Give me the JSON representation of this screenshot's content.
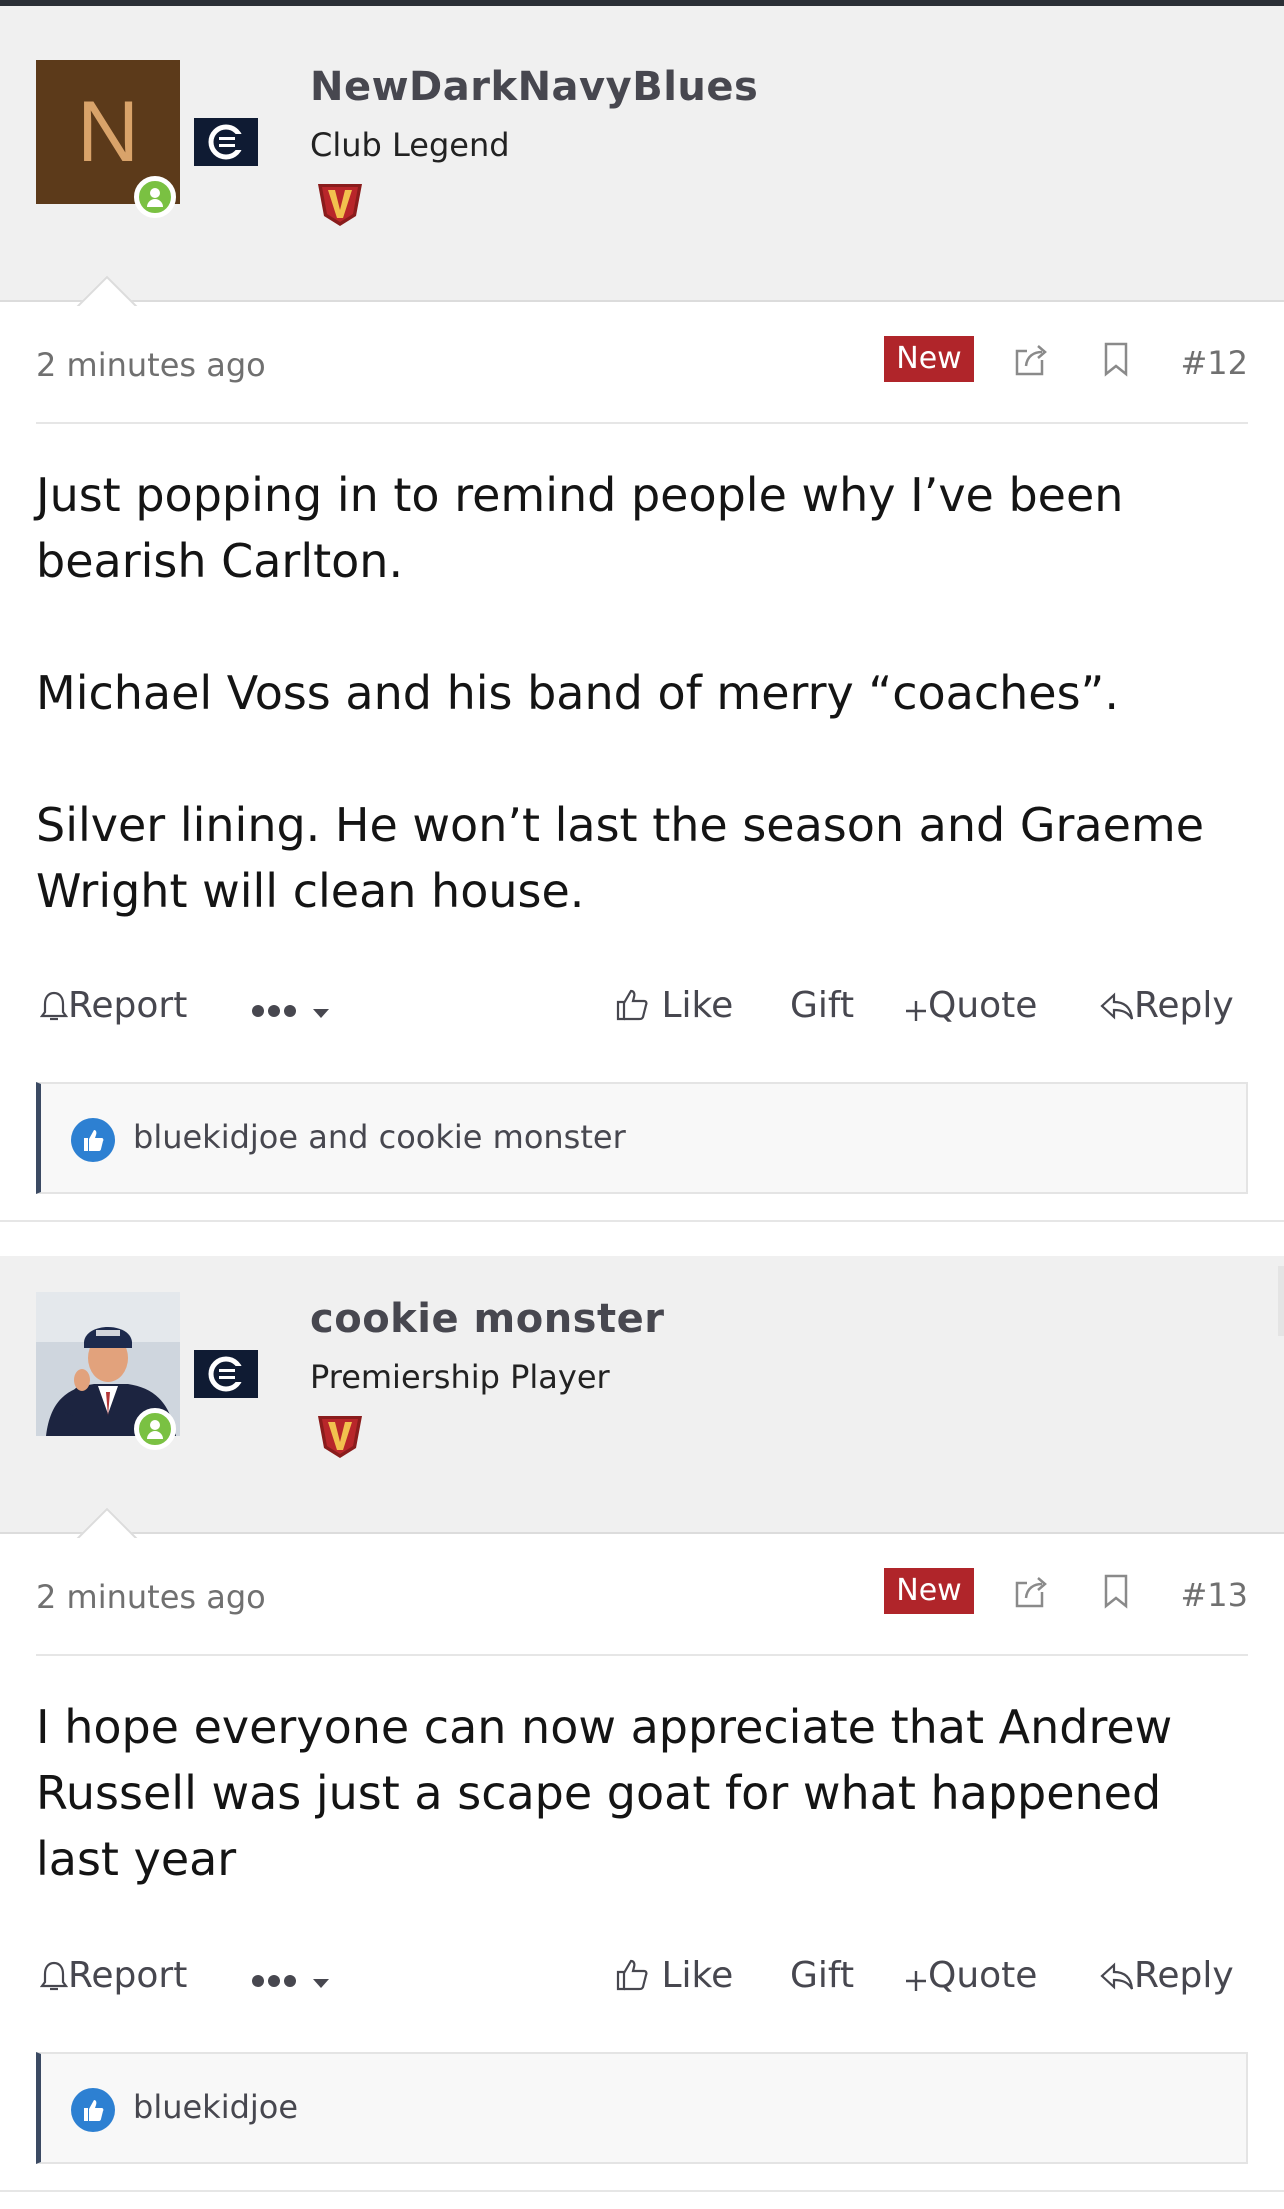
{
  "colors": {
    "new_badge": "#b0252a",
    "online": "#7ac142",
    "reaction": "#2d80d2",
    "accent_bar": "#3b4a63"
  },
  "posts": [
    {
      "user": {
        "avatar_letter": "N",
        "name": "NewDarkNavyBlues",
        "title": "Club Legend"
      },
      "time": "2 minutes ago",
      "new_label": "New",
      "number": "#12",
      "paragraphs": [
        "Just popping in to remind people why I’ve been bearish Carlton.",
        "Michael Voss and his band of merry “coaches”.",
        "Silver lining. He won’t last the season and Graeme Wright will clean house."
      ],
      "reactions": "bluekidjoe and cookie monster"
    },
    {
      "user": {
        "name": "cookie monster",
        "title": "Premiership Player"
      },
      "time": "2 minutes ago",
      "new_label": "New",
      "number": "#13",
      "paragraphs": [
        "I hope everyone can now appreciate that Andrew Russell was just a scape goat for what happened last year"
      ],
      "reactions": "bluekidjoe"
    }
  ],
  "actions": {
    "report": "Report",
    "like": "Like",
    "gift": "Gift",
    "quote": "Quote",
    "reply": "Reply"
  },
  "icons": [
    "share-icon",
    "bookmark-icon",
    "bell-icon",
    "more-icon",
    "thumbs-up-icon",
    "plus-icon",
    "reply-icon",
    "online-icon",
    "club-logo-icon",
    "rank-badge-icon"
  ]
}
